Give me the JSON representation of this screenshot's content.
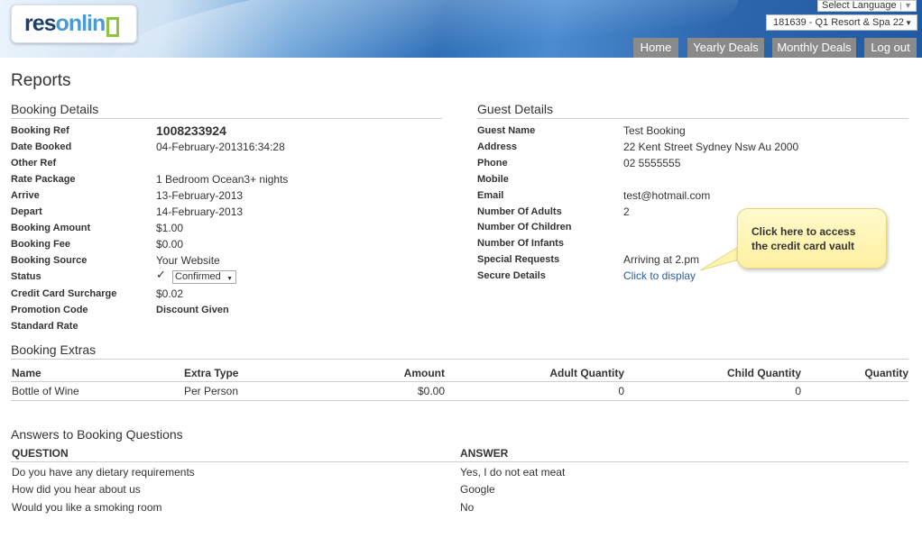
{
  "header": {
    "logo_part1": "res",
    "logo_part2": "onlin",
    "language_label": "Select Language",
    "property_selected": "181639 - Q1 Resort & Spa 22",
    "nav": [
      "Home",
      "Yearly Deals",
      "Monthly Deals",
      "Log out"
    ]
  },
  "page_title": "Reports",
  "booking_details": {
    "title": "Booking Details",
    "booking_ref_label": "Booking Ref",
    "booking_ref": "1008233924",
    "date_booked_label": "Date Booked",
    "date_booked": "04-February-201316:34:28",
    "other_ref_label": "Other Ref",
    "rate_package_label": "Rate Package",
    "rate_package": "1 Bedroom Ocean3+ nights",
    "arrive_label": "Arrive",
    "arrive": "13-February-2013",
    "depart_label": "Depart",
    "depart": "14-February-2013",
    "booking_amount_label": "Booking Amount",
    "booking_amount": "$1.00",
    "booking_fee_label": "Booking Fee",
    "booking_fee": "$0.00",
    "booking_source_label": "Booking Source",
    "booking_source": "Your Website",
    "status_label": "Status",
    "status": "Confirmed",
    "cc_surcharge_label": "Credit Card Surcharge",
    "cc_surcharge": "$0.02",
    "promotion_code_label": "Promotion Code",
    "promotion_code": "Discount Given",
    "standard_rate_label": "Standard Rate"
  },
  "guest_details": {
    "title": "Guest Details",
    "guest_name_label": "Guest Name",
    "guest_name": "Test Booking",
    "address_label": "Address",
    "address": "22 Kent Street Sydney Nsw Au 2000",
    "phone_label": "Phone",
    "phone": "02 5555555",
    "mobile_label": "Mobile",
    "email_label": "Email",
    "email": "test@hotmail.com",
    "adults_label": "Number Of Adults",
    "adults": "2",
    "children_label": "Number Of Children",
    "infants_label": "Number Of Infants",
    "special_requests_label": "Special Requests",
    "special_requests": "Arriving at 2.pm",
    "secure_details_label": "Secure Details",
    "secure_details_link": "Click to display"
  },
  "callout": {
    "line1": "Click here to access",
    "line2": "the credit card vault"
  },
  "extras": {
    "title": "Booking Extras",
    "headers": [
      "Name",
      "Extra Type",
      "Amount",
      "Adult Quantity",
      "Child Quantity",
      "Quantity"
    ],
    "rows": [
      [
        "Bottle of Wine",
        "Per Person",
        "$0.00",
        "0",
        "0",
        ""
      ]
    ]
  },
  "questions": {
    "title": "Answers to Booking Questions",
    "q_header": "QUESTION",
    "a_header": "ANSWER",
    "rows": [
      [
        "Do you have any dietary requirements",
        "Yes, I do not eat meat"
      ],
      [
        "How did you hear about us",
        "Google"
      ],
      [
        "Would you like a smoking room",
        "No"
      ]
    ]
  }
}
